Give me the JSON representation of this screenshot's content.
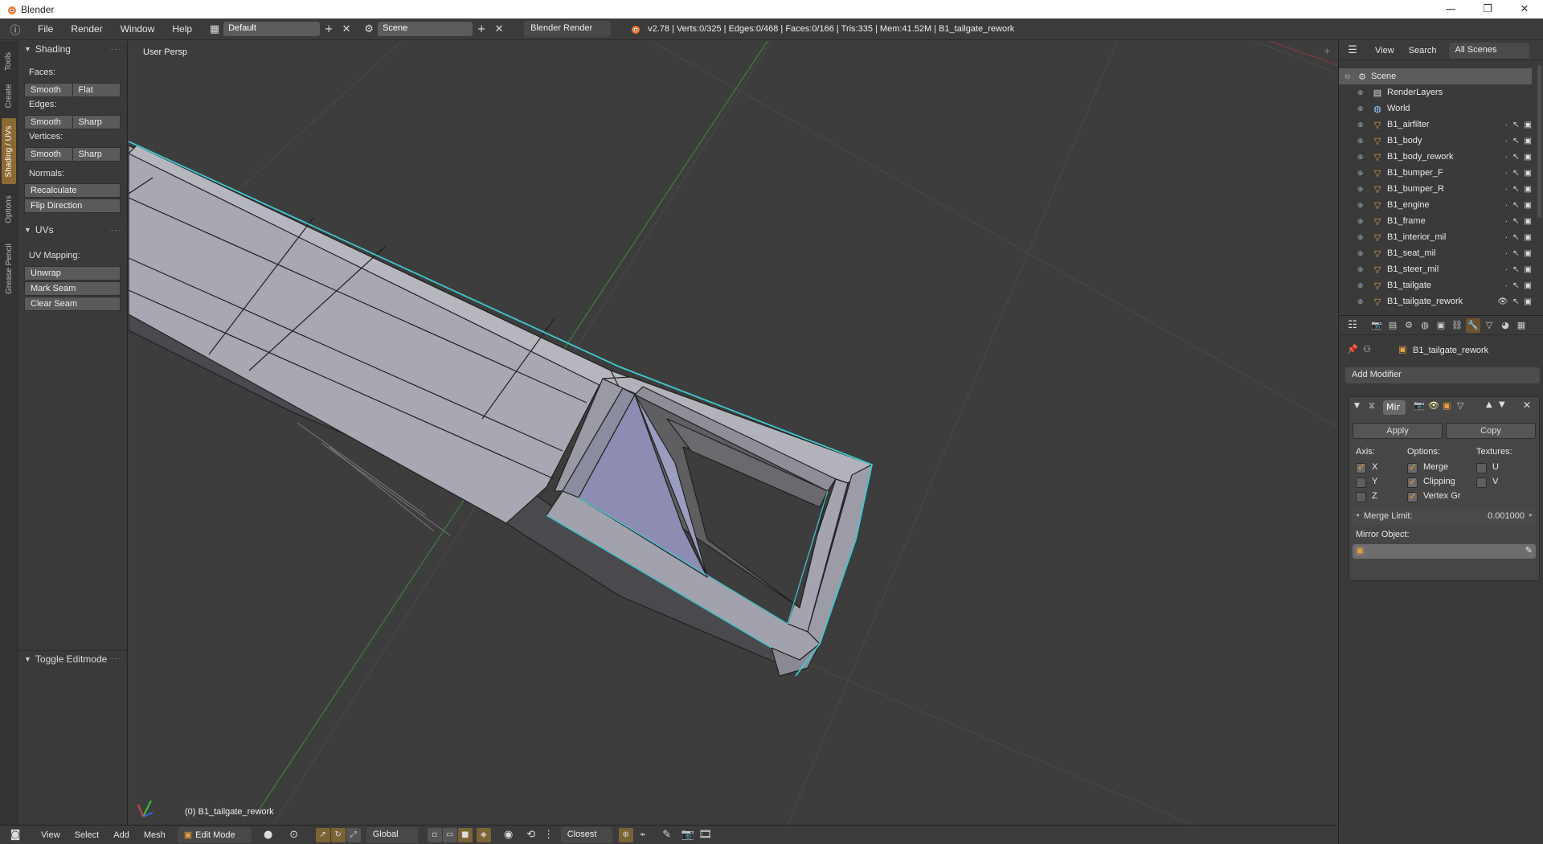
{
  "window": {
    "title": "Blender",
    "minimize": "—",
    "maximize": "❐",
    "close": "✕"
  },
  "info_header": {
    "menus": [
      "File",
      "Render",
      "Window",
      "Help"
    ],
    "layout": "Default",
    "scene": "Scene",
    "engine": "Blender Render",
    "stats": "v2.78 | Verts:0/325 | Edges:0/468 | Faces:0/166 | Tris:335 | Mem:41.52M | B1_tailgate_rework"
  },
  "tool_tabs": [
    "Tools",
    "Create",
    "Shading / UVs",
    "Options",
    "Grease Pencil"
  ],
  "shading_panel": {
    "title": "Shading",
    "faces_label": "Faces:",
    "faces": [
      "Smooth",
      "Flat"
    ],
    "edges_label": "Edges:",
    "edges": [
      "Smooth",
      "Sharp"
    ],
    "vertices_label": "Vertices:",
    "vertices": [
      "Smooth",
      "Sharp"
    ],
    "normals_label": "Normals:",
    "recalculate": "Recalculate",
    "flip": "Flip Direction"
  },
  "uvs_panel": {
    "title": "UVs",
    "mapping_label": "UV Mapping:",
    "unwrap": "Unwrap",
    "mark_seam": "Mark Seam",
    "clear_seam": "Clear Seam"
  },
  "operator_panel": {
    "title": "Toggle Editmode"
  },
  "viewport": {
    "view_label": "User Persp",
    "object_label": "(0) B1_tailgate_rework"
  },
  "bottom_header": {
    "menus": [
      "View",
      "Select",
      "Add",
      "Mesh"
    ],
    "mode": "Edit Mode",
    "orientation": "Global",
    "snap": "Closest"
  },
  "outliner": {
    "menus": [
      "View",
      "Search"
    ],
    "filter": "All Scenes",
    "items": [
      {
        "name": "Scene",
        "level": 0
      },
      {
        "name": "RenderLayers",
        "level": 1
      },
      {
        "name": "World",
        "level": 1
      },
      {
        "name": "B1_airfilter",
        "level": 1
      },
      {
        "name": "B1_body",
        "level": 1
      },
      {
        "name": "B1_body_rework",
        "level": 1
      },
      {
        "name": "B1_bumper_F",
        "level": 1
      },
      {
        "name": "B1_bumper_R",
        "level": 1
      },
      {
        "name": "B1_engine",
        "level": 1
      },
      {
        "name": "B1_frame",
        "level": 1
      },
      {
        "name": "B1_interior_mil",
        "level": 1
      },
      {
        "name": "B1_seat_mil",
        "level": 1
      },
      {
        "name": "B1_steer_mil",
        "level": 1
      },
      {
        "name": "B1_tailgate",
        "level": 1
      },
      {
        "name": "B1_tailgate_rework",
        "level": 1
      }
    ]
  },
  "properties": {
    "object_name": "B1_tailgate_rework",
    "add_modifier": "Add Modifier",
    "modifier_name": "Mir",
    "apply": "Apply",
    "copy": "Copy",
    "axis_label": "Axis:",
    "options_label": "Options:",
    "textures_label": "Textures:",
    "axis": [
      {
        "label": "X",
        "checked": true
      },
      {
        "label": "Y",
        "checked": false
      },
      {
        "label": "Z",
        "checked": false
      }
    ],
    "options": [
      {
        "label": "Merge",
        "checked": true
      },
      {
        "label": "Clipping",
        "checked": true
      },
      {
        "label": "Vertex Gr",
        "checked": true
      }
    ],
    "textures": [
      {
        "label": "U",
        "checked": false
      },
      {
        "label": "V",
        "checked": false
      }
    ],
    "merge_limit_label": "Merge Limit:",
    "merge_limit": "0.001000",
    "mirror_object_label": "Mirror Object:"
  },
  "colors": {
    "accent": "#e8a040",
    "selection_edge": "#3fc8d0",
    "mesh_face": "#a5a5b0",
    "tab_active": "#8c6a32"
  }
}
